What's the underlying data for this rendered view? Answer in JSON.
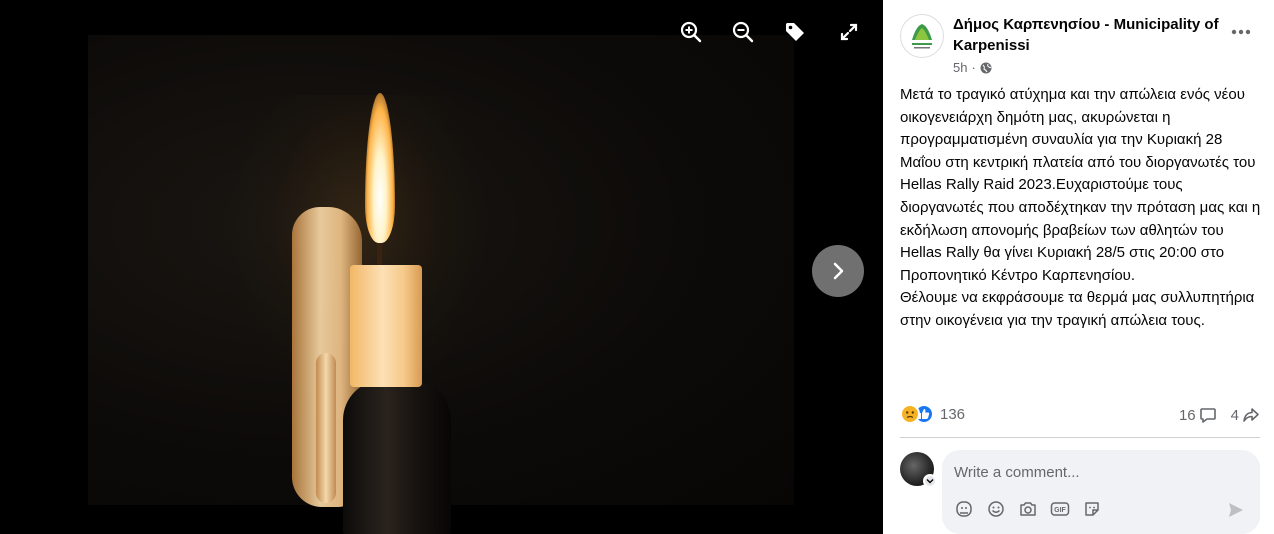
{
  "viewer": {
    "tools": [
      "zoom-in-icon",
      "zoom-out-icon",
      "tag-icon",
      "expand-icon"
    ],
    "next_icon": "chevron-right-icon"
  },
  "post": {
    "page_name": "Δήμος Καρπενησίου - Municipality of Karpenissi",
    "time": "5h",
    "privacy_icon": "globe-icon",
    "text": "Μετά το τραγικό ατύχημα και την απώλεια ενός νέου οικογενειάρχη δημότη μας, ακυρώνεται η προγραμματισμένη συναυλία για την Κυριακή 28 Μαΐου στη κεντρική πλατεία από του διοργανωτές του Hellas Rally Raid 2023.Ευχαριστούμε τους διοργανωτές που αποδέχτηκαν την πρόταση μας και η εκδήλωση απονομής βραβείων των αθλητών του Hellas Rally θα γίνει Κυριακή 28/5 στις 20:00 στο Προπονητικό Κέντρο Καρπενησίου.\nΘέλουμε να εκφράσουμε τα θερμά μας συλλυπητήρια στην οικογένεια για την τραγική απώλεια τους.",
    "reactions": {
      "count": "136",
      "types": [
        "sad",
        "like"
      ]
    },
    "comments_count": "16",
    "shares_count": "4"
  },
  "comment": {
    "placeholder": "Write a comment...",
    "tools": [
      "avatar-sticker-icon",
      "emoji-icon",
      "camera-icon",
      "gif-icon",
      "sticker-icon"
    ]
  },
  "colors": {
    "viewer_bg": "#000000",
    "text": "#050505",
    "secondary": "#65676b",
    "like_blue": "#1877f2",
    "sad_yellow": "#f7b125"
  }
}
